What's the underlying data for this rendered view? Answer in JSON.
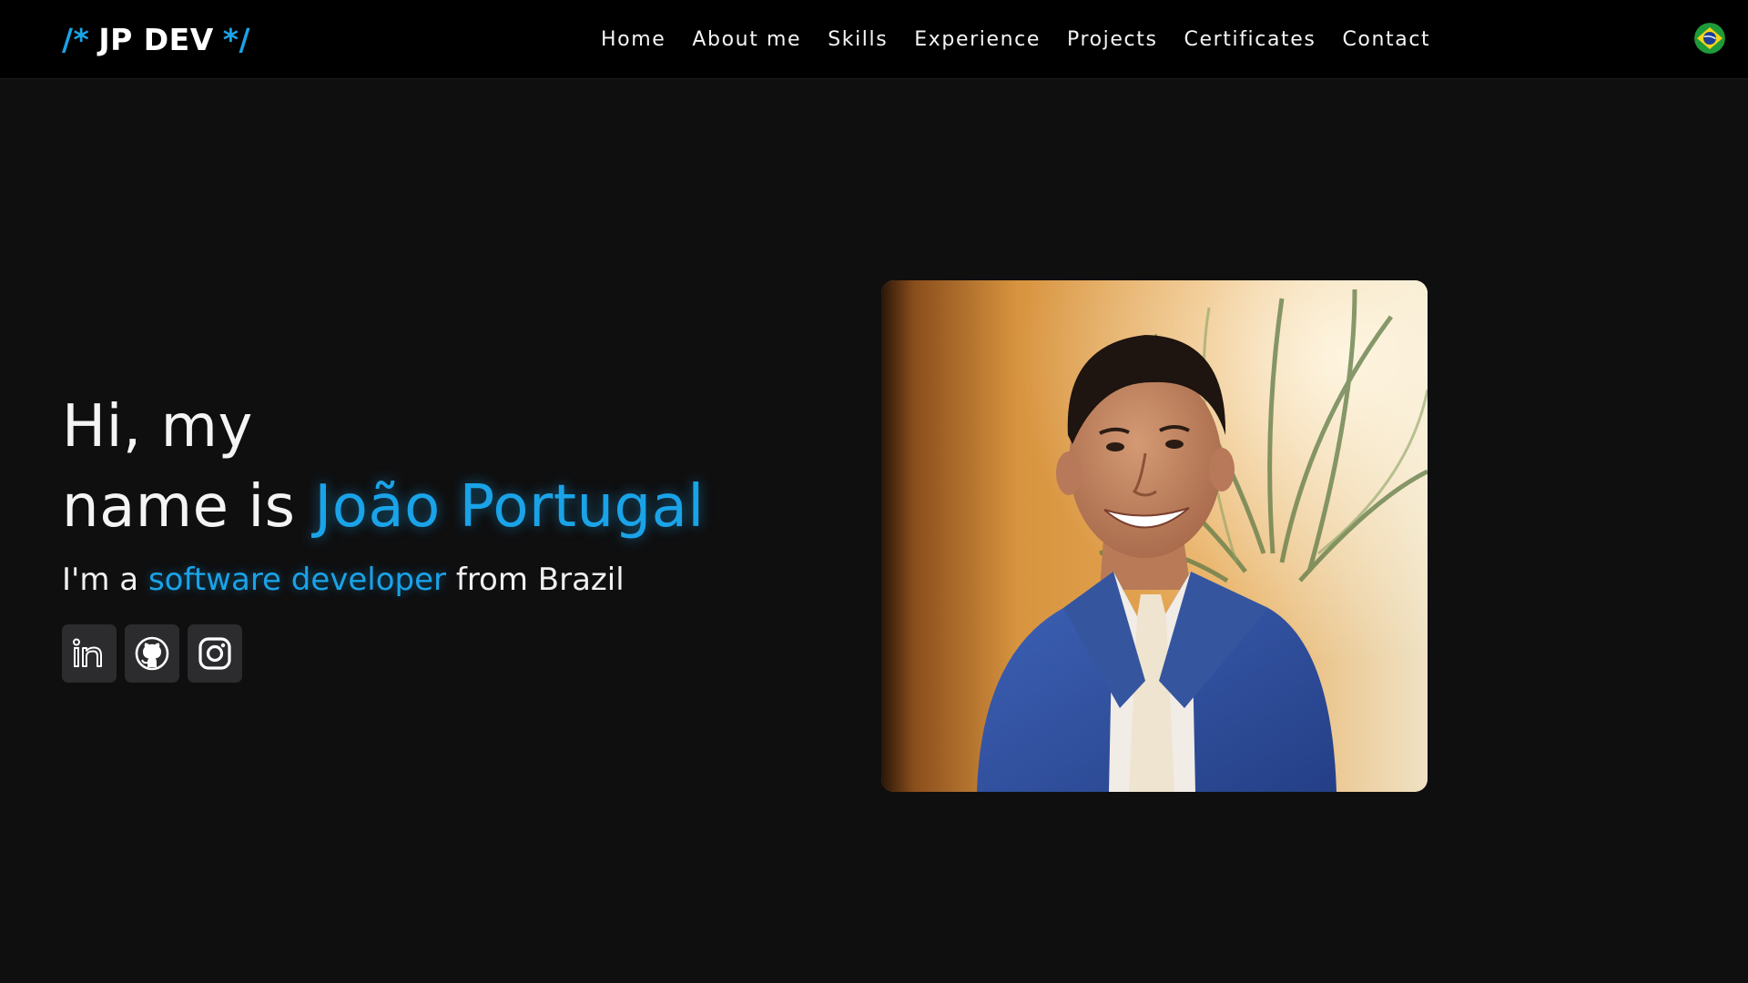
{
  "logo": {
    "open_comment": "/*",
    "name": "JP DEV",
    "close_comment": "*/"
  },
  "nav": {
    "items": [
      {
        "label": "Home"
      },
      {
        "label": "About me"
      },
      {
        "label": "Skills"
      },
      {
        "label": "Experience"
      },
      {
        "label": "Projects"
      },
      {
        "label": "Certificates"
      },
      {
        "label": "Contact"
      }
    ],
    "language_icon": "brazil-flag-icon"
  },
  "hero": {
    "line1": "Hi, my",
    "line2_prefix": "name is ",
    "name": "João Portugal",
    "tagline_prefix": "I'm a ",
    "tagline_highlight": "software developer",
    "tagline_suffix": " from Brazil"
  },
  "socials": [
    {
      "icon": "linkedin-icon"
    },
    {
      "icon": "github-icon"
    },
    {
      "icon": "instagram-icon"
    }
  ],
  "portrait": {
    "subject": "profile-photo"
  },
  "colors": {
    "background": "#0f0f10",
    "navbar": "#000000",
    "accent": "#1aa3e8",
    "text": "#f4f4f4",
    "social_button": "#2c2c2e"
  }
}
